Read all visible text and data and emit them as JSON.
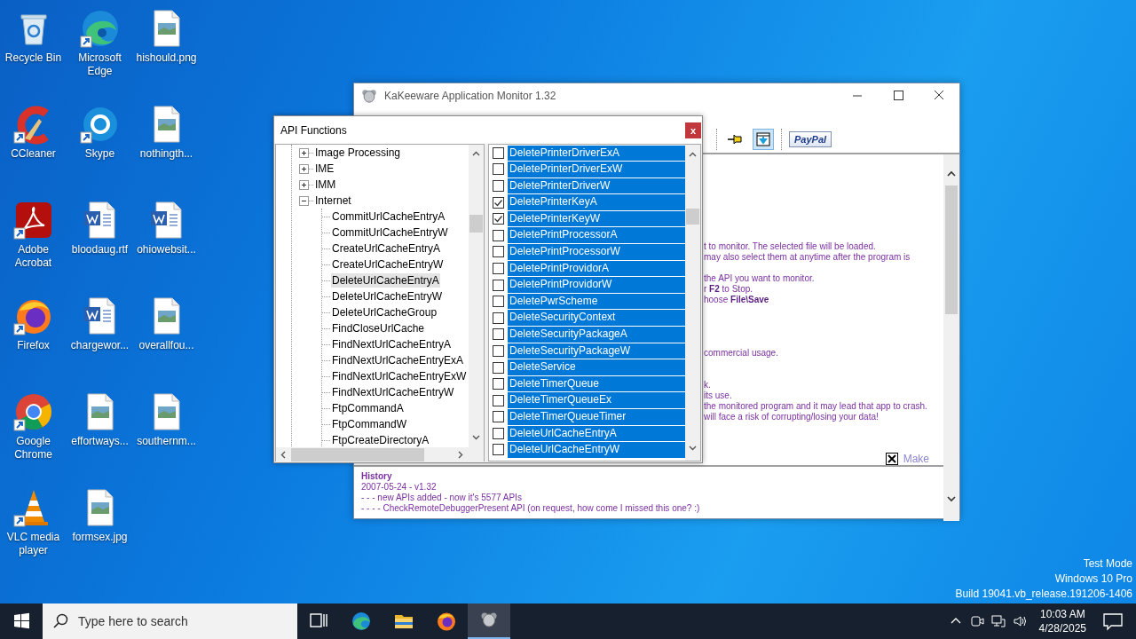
{
  "desktop": {
    "icons": [
      {
        "label": "Recycle Bin",
        "kind": "recycle",
        "shortcut": false
      },
      {
        "label": "CCleaner",
        "kind": "ccleaner",
        "shortcut": true
      },
      {
        "label": "Adobe Acrobat",
        "kind": "acrobat",
        "shortcut": true
      },
      {
        "label": "Firefox",
        "kind": "firefox",
        "shortcut": true
      },
      {
        "label": "Google Chrome",
        "kind": "chrome",
        "shortcut": true
      },
      {
        "label": "VLC media player",
        "kind": "vlc",
        "shortcut": true
      },
      {
        "label": "Microsoft Edge",
        "kind": "edge",
        "shortcut": true
      },
      {
        "label": "Skype",
        "kind": "skype",
        "shortcut": true
      },
      {
        "label": "bloodaug.rtf",
        "kind": "word",
        "shortcut": false
      },
      {
        "label": "chargewor...",
        "kind": "word",
        "shortcut": false
      },
      {
        "label": "effortways...",
        "kind": "image",
        "shortcut": false
      },
      {
        "label": "formsex.jpg",
        "kind": "image",
        "shortcut": false
      },
      {
        "label": "hishould.png",
        "kind": "image",
        "shortcut": false
      },
      {
        "label": "nothingth...",
        "kind": "image",
        "shortcut": false
      },
      {
        "label": "ohiowebsit...",
        "kind": "word",
        "shortcut": false
      },
      {
        "label": "overallfou...",
        "kind": "image",
        "shortcut": false
      },
      {
        "label": "southernm...",
        "kind": "image",
        "shortcut": false
      }
    ],
    "os_notice": [
      "Test Mode",
      "Windows 10 Pro",
      "Build 19041.vb_release.191206-1406"
    ]
  },
  "main_window": {
    "title": "KaKeeware Application Monitor 1.32",
    "toolbar": [
      {
        "kind": "pin",
        "pressed": false
      },
      {
        "kind": "capture",
        "pressed": true
      },
      {
        "kind": "paypal",
        "label": "PayPal",
        "pressed": false
      }
    ],
    "content": {
      "paragraphs": [
        [
          "t to monitor. The selected file will be loaded.",
          "may also select them at anytime after the program is"
        ],
        [
          "the API you want to monitor.",
          "r **F2** to Stop.",
          "hoose **File\\Save**"
        ],
        [
          "commercial usage."
        ],
        [
          "k.",
          "its use.",
          "the monitored program and it may lead that app to crash.",
          "will face a risk of corrupting/losing your data!"
        ]
      ],
      "make_link": "Make"
    },
    "history": {
      "title": "History",
      "lines": [
        "2007-05-24 - v1.32",
        "- - - new APIs added - now it's 5577 APIs",
        "- - - - CheckRemoteDebuggerPresent API (on request, how come I missed this one? :)"
      ]
    }
  },
  "dialog": {
    "title": "API Functions",
    "close_label": "x",
    "tree": [
      {
        "label": "Image Processing",
        "expanded": false,
        "selected": false
      },
      {
        "label": "IME",
        "expanded": false,
        "selected": false
      },
      {
        "label": "IMM",
        "expanded": false,
        "selected": false
      },
      {
        "label": "Internet",
        "expanded": true,
        "selected": false,
        "children": [
          {
            "label": "CommitUrlCacheEntryA",
            "selected": false
          },
          {
            "label": "CommitUrlCacheEntryW",
            "selected": false
          },
          {
            "label": "CreateUrlCacheEntryA",
            "selected": false
          },
          {
            "label": "CreateUrlCacheEntryW",
            "selected": false
          },
          {
            "label": "DeleteUrlCacheEntryA",
            "selected": true
          },
          {
            "label": "DeleteUrlCacheEntryW",
            "selected": false
          },
          {
            "label": "DeleteUrlCacheGroup",
            "selected": false
          },
          {
            "label": "FindCloseUrlCache",
            "selected": false
          },
          {
            "label": "FindNextUrlCacheEntryA",
            "selected": false
          },
          {
            "label": "FindNextUrlCacheEntryExA",
            "selected": false
          },
          {
            "label": "FindNextUrlCacheEntryExW",
            "selected": false
          },
          {
            "label": "FindNextUrlCacheEntryW",
            "selected": false
          },
          {
            "label": "FtpCommandA",
            "selected": false
          },
          {
            "label": "FtpCommandW",
            "selected": false
          },
          {
            "label": "FtpCreateDirectoryA",
            "selected": false
          }
        ]
      }
    ],
    "api_list": [
      {
        "name": "DeletePrinterDriverExA",
        "checked": false,
        "selected": true
      },
      {
        "name": "DeletePrinterDriverExW",
        "checked": false,
        "selected": true
      },
      {
        "name": "DeletePrinterDriverW",
        "checked": false,
        "selected": true
      },
      {
        "name": "DeletePrinterKeyA",
        "checked": true,
        "selected": true
      },
      {
        "name": "DeletePrinterKeyW",
        "checked": true,
        "selected": true
      },
      {
        "name": "DeletePrintProcessorA",
        "checked": false,
        "selected": true
      },
      {
        "name": "DeletePrintProcessorW",
        "checked": false,
        "selected": true
      },
      {
        "name": "DeletePrintProvidorA",
        "checked": false,
        "selected": true
      },
      {
        "name": "DeletePrintProvidorW",
        "checked": false,
        "selected": true
      },
      {
        "name": "DeletePwrScheme",
        "checked": false,
        "selected": true
      },
      {
        "name": "DeleteSecurityContext",
        "checked": false,
        "selected": true
      },
      {
        "name": "DeleteSecurityPackageA",
        "checked": false,
        "selected": true
      },
      {
        "name": "DeleteSecurityPackageW",
        "checked": false,
        "selected": true
      },
      {
        "name": "DeleteService",
        "checked": false,
        "selected": true
      },
      {
        "name": "DeleteTimerQueue",
        "checked": false,
        "selected": true
      },
      {
        "name": "DeleteTimerQueueEx",
        "checked": false,
        "selected": true
      },
      {
        "name": "DeleteTimerQueueTimer",
        "checked": false,
        "selected": true
      },
      {
        "name": "DeleteUrlCacheEntryA",
        "checked": false,
        "selected": true
      },
      {
        "name": "DeleteUrlCacheEntryW",
        "checked": false,
        "selected": true
      }
    ]
  },
  "taskbar": {
    "search_placeholder": "Type here to search",
    "apps": [
      {
        "kind": "taskview",
        "active": false
      },
      {
        "kind": "edge",
        "active": false
      },
      {
        "kind": "explorer",
        "active": false
      },
      {
        "kind": "firefox",
        "active": false
      },
      {
        "kind": "kakeeware",
        "active": true
      }
    ],
    "time": "10:03 AM",
    "date": "4/28/2025"
  }
}
